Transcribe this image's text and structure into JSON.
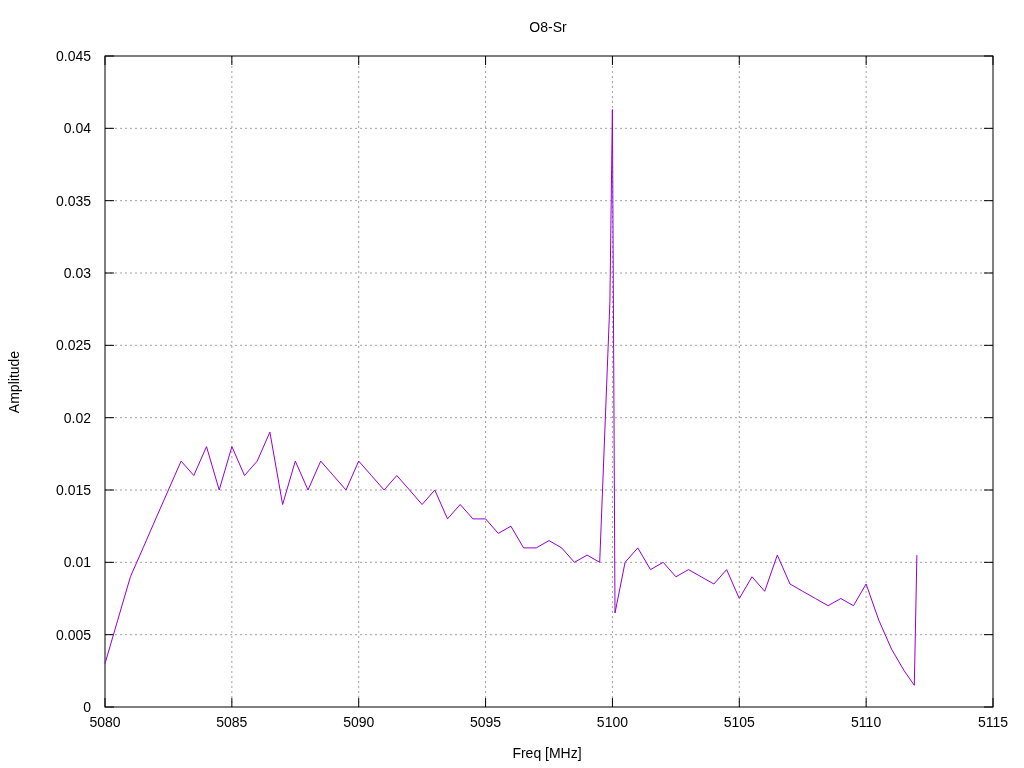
{
  "chart": {
    "chart_data": {
      "type": "line",
      "title": "O8-Sr",
      "xlabel": "Freq [MHz]",
      "ylabel": "Amplitude",
      "x": [
        5080,
        5080.5,
        5081,
        5081.5,
        5082,
        5082.5,
        5083,
        5083.5,
        5084,
        5084.5,
        5085,
        5085.5,
        5086,
        5086.5,
        5087,
        5087.5,
        5088,
        5088.5,
        5089,
        5089.5,
        5090,
        5090.5,
        5091,
        5091.5,
        5092,
        5092.5,
        5093,
        5093.5,
        5094,
        5094.5,
        5095,
        5095.5,
        5096,
        5096.5,
        5097,
        5097.5,
        5098,
        5098.5,
        5099,
        5099.5,
        5099.9,
        5100,
        5100.1,
        5100.5,
        5101,
        5101.5,
        5102,
        5102.5,
        5103,
        5103.5,
        5104,
        5104.5,
        5105,
        5105.5,
        5106,
        5106.5,
        5107,
        5107.5,
        5108,
        5108.5,
        5109,
        5109.5,
        5110,
        5110.5,
        5111,
        5111.5,
        5111.9,
        5112
      ],
      "series": [
        {
          "color": "#9400d3",
          "values": [
            0.003,
            0.006,
            0.009,
            0.011,
            0.013,
            0.015,
            0.017,
            0.016,
            0.018,
            0.015,
            0.018,
            0.016,
            0.017,
            0.019,
            0.014,
            0.017,
            0.015,
            0.017,
            0.016,
            0.015,
            0.017,
            0.016,
            0.015,
            0.016,
            0.015,
            0.014,
            0.015,
            0.013,
            0.014,
            0.013,
            0.013,
            0.012,
            0.0125,
            0.011,
            0.011,
            0.0115,
            0.011,
            0.01,
            0.0105,
            0.01,
            0.028,
            0.0413,
            0.0065,
            0.01,
            0.011,
            0.0095,
            0.01,
            0.009,
            0.0095,
            0.009,
            0.0085,
            0.0095,
            0.0075,
            0.009,
            0.008,
            0.0105,
            0.0085,
            0.008,
            0.0075,
            0.007,
            0.0075,
            0.007,
            0.0085,
            0.006,
            0.004,
            0.0025,
            0.0015,
            0.0105
          ]
        }
      ],
      "grid": true,
      "xlim": [
        5080,
        5115
      ],
      "ylim": [
        0,
        0.045
      ],
      "xticks": [
        5080,
        5085,
        5090,
        5095,
        5100,
        5105,
        5110,
        5115
      ],
      "yticks": [
        {
          "value": 0,
          "label": "0"
        },
        {
          "value": 0.005,
          "label": "0.005"
        },
        {
          "value": 0.01,
          "label": "0.01"
        },
        {
          "value": 0.015,
          "label": "0.015"
        },
        {
          "value": 0.02,
          "label": "0.02"
        },
        {
          "value": 0.025,
          "label": "0.025"
        },
        {
          "value": 0.03,
          "label": "0.03"
        },
        {
          "value": 0.035,
          "label": "0.035"
        },
        {
          "value": 0.04,
          "label": "0.04"
        },
        {
          "value": 0.045,
          "label": "0.045"
        }
      ]
    }
  }
}
